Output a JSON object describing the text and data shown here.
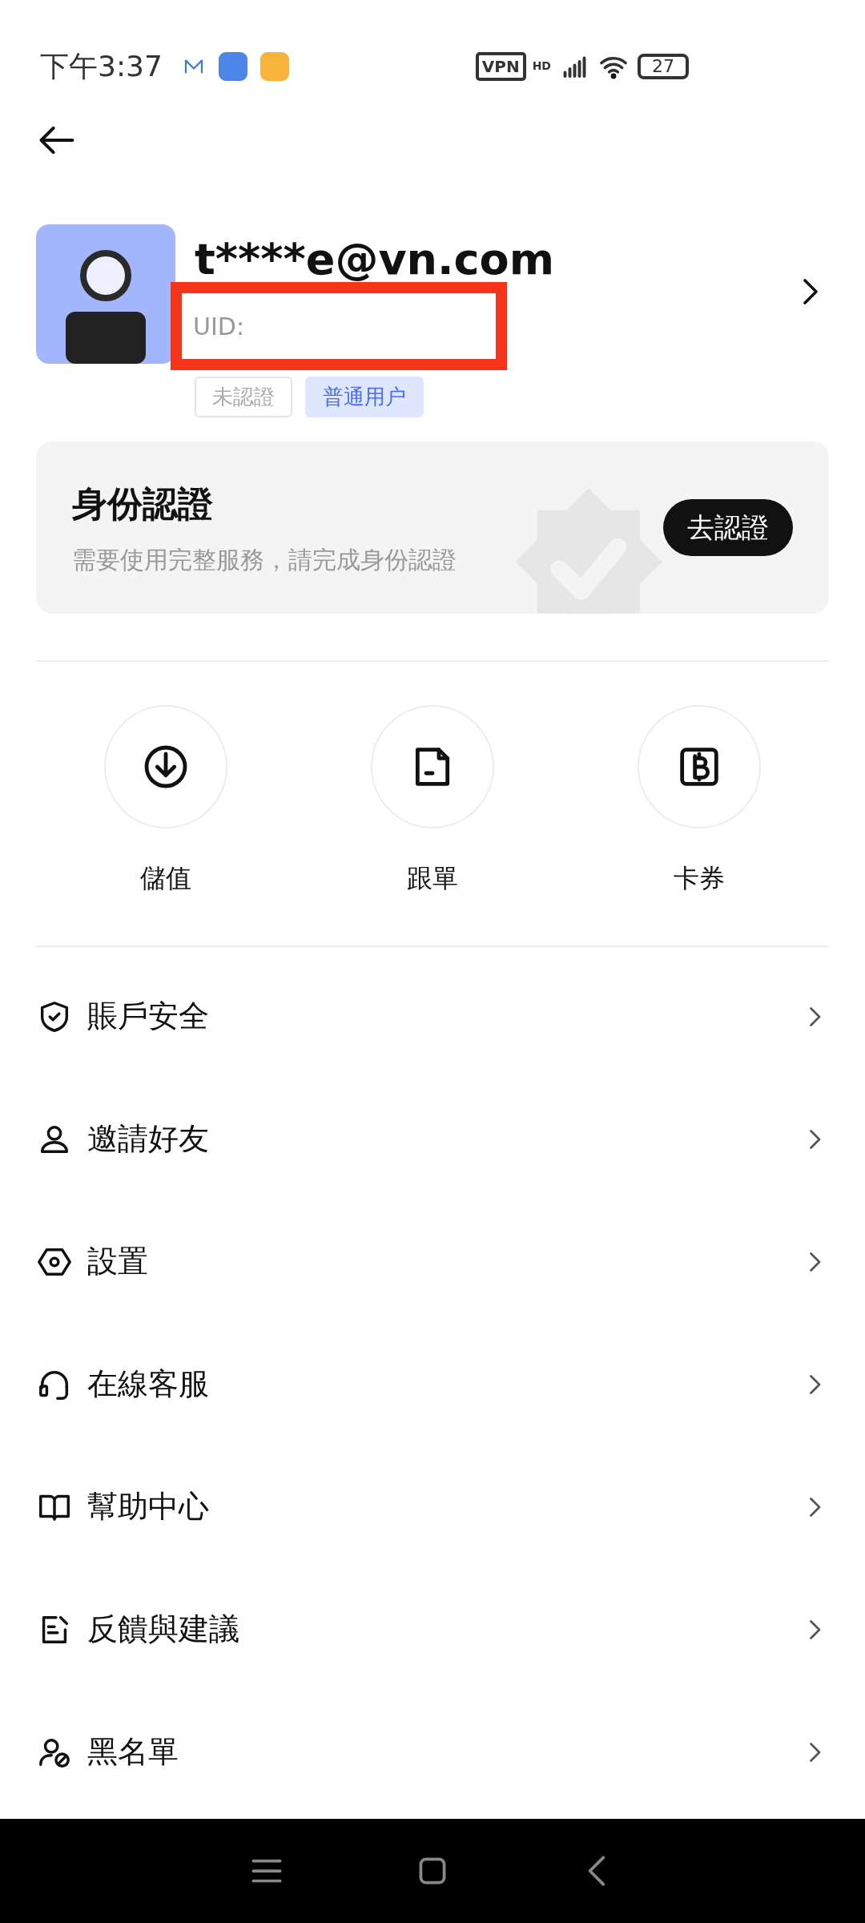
{
  "status_bar": {
    "time": "下午3:37",
    "vpn": "VPN",
    "network": "HD",
    "battery": "27"
  },
  "profile": {
    "email": "t****e@vn.com",
    "uid_label": "UID:",
    "tags": [
      {
        "label": "未認證",
        "kind": "plain"
      },
      {
        "label": "普通用户",
        "kind": "blue"
      }
    ]
  },
  "verify_card": {
    "title": "身份認證",
    "subtitle": "需要使用完整服務，請完成身份認證",
    "button": "去認證"
  },
  "shortcuts": [
    {
      "label": "儲值",
      "kind": "deposit"
    },
    {
      "label": "跟單",
      "kind": "doc"
    },
    {
      "label": "卡券",
      "kind": "coupon"
    }
  ],
  "menu": [
    {
      "label": "賬戶安全",
      "kind": "shield"
    },
    {
      "label": "邀請好友",
      "kind": "user"
    },
    {
      "label": "設置",
      "kind": "hex"
    },
    {
      "label": "在線客服",
      "kind": "headset"
    },
    {
      "label": "幫助中心",
      "kind": "book"
    },
    {
      "label": "反饋與建議",
      "kind": "note"
    },
    {
      "label": "黑名單",
      "kind": "block"
    }
  ]
}
